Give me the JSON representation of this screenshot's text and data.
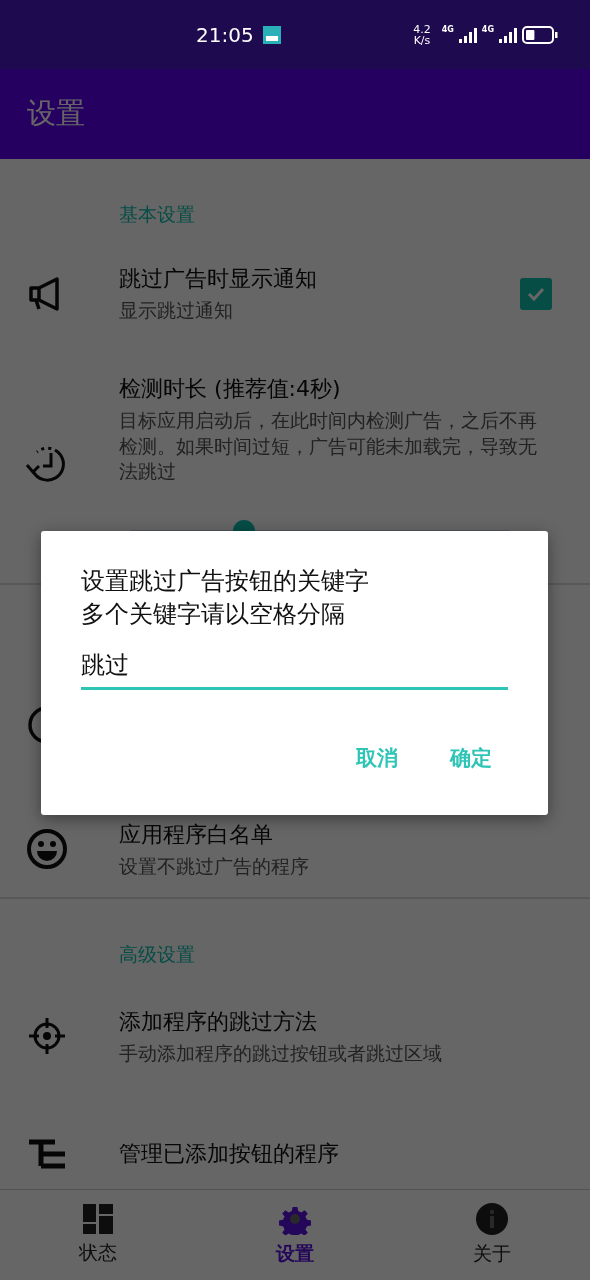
{
  "status_bar": {
    "time": "21:05",
    "net_speed": [
      "4.2",
      "K/s"
    ],
    "signals": [
      {
        "network": "4G"
      },
      {
        "network": "4G"
      }
    ],
    "battery": {
      "level": 0.35
    }
  },
  "app_bar": {
    "title": "设置"
  },
  "sections": [
    {
      "header": "基本设置",
      "items": [
        {
          "kind": "checkbox",
          "title": "跳过广告时显示通知",
          "subtitle": "显示跳过通知",
          "checked": true
        },
        {
          "kind": "slider",
          "title": "检测时长 (推荐值:4秒)",
          "subtitle": "目标应用启动后，在此时间内检测广告，之后不再检测。如果时间过短，广告可能未加载完，导致无法跳过",
          "level": 0.3
        },
        {
          "kind": "covered"
        },
        {
          "kind": "plain",
          "title": "应用程序白名单",
          "subtitle": "设置不跳过广告的程序"
        }
      ]
    },
    {
      "header": "高级设置",
      "items": [
        {
          "kind": "plain",
          "title": "添加程序的跳过方法",
          "subtitle": "手动添加程序的跳过按钮或者跳过区域"
        },
        {
          "kind": "cut",
          "title": "管理已添加按钮的程序"
        }
      ]
    }
  ],
  "dialog": {
    "title_lines": [
      "设置跳过广告按钮的关键字",
      "多个关键字请以空格分隔"
    ],
    "input": {
      "value": "跳过"
    },
    "buttons": [
      "取消",
      "确定"
    ]
  },
  "bottom_nav": [
    {
      "label": "状态",
      "selected": false
    },
    {
      "label": "设置",
      "selected": true
    },
    {
      "label": "关于",
      "selected": false
    }
  ]
}
